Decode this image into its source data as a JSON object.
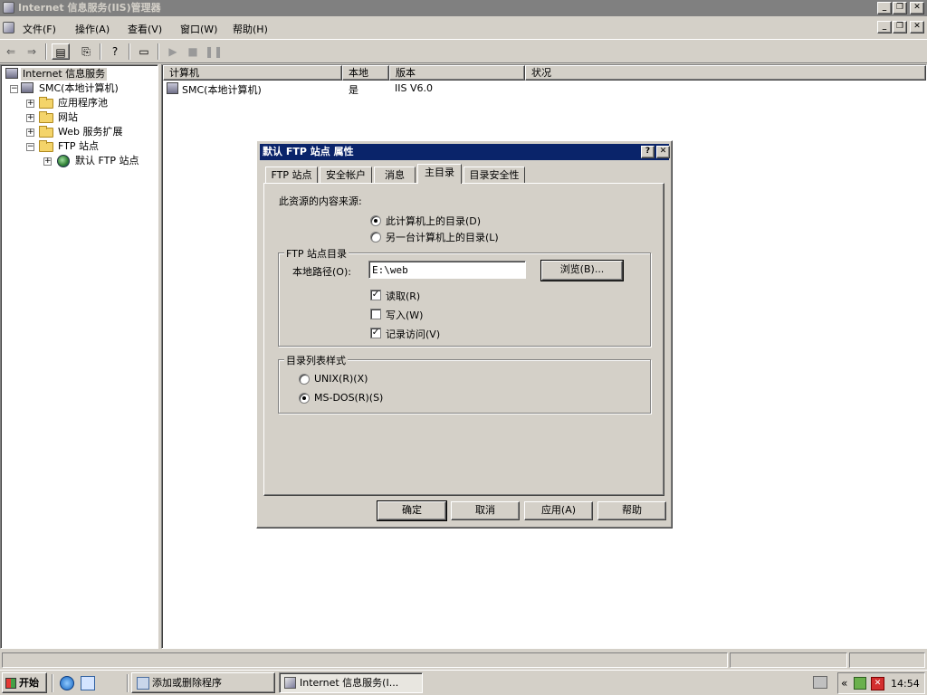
{
  "window": {
    "title": "Internet 信息服务(IIS)管理器"
  },
  "menu": [
    "文件(F)",
    "操作(A)",
    "查看(V)",
    "窗口(W)",
    "帮助(H)"
  ],
  "tree": {
    "root": "Internet 信息服务",
    "computer": "SMC(本地计算机)",
    "app_pools": "应用程序池",
    "websites": "网站",
    "web_ext": "Web 服务扩展",
    "ftp_sites": "FTP 站点",
    "default_ftp": "默认 FTP 站点"
  },
  "list": {
    "columns": [
      "计算机",
      "本地",
      "版本",
      "状况"
    ],
    "rows": [
      {
        "computer": "SMC(本地计算机)",
        "local": "是",
        "version": "IIS V6.0",
        "status": ""
      }
    ]
  },
  "dialog": {
    "title": "默认 FTP 站点 属性",
    "tabs": [
      "FTP 站点",
      "安全帐户",
      "消息",
      "主目录",
      "目录安全性"
    ],
    "active_tab": "主目录",
    "source_label": "此资源的内容来源:",
    "source_options": [
      "此计算机上的目录(D)",
      "另一台计算机上的目录(L)"
    ],
    "group_dir": "FTP 站点目录",
    "local_path_label": "本地路径(O):",
    "local_path_value": "E:\\web",
    "browse_button": "浏览(B)...",
    "perm_read": "读取(R)",
    "perm_write": "写入(W)",
    "perm_log": "记录访问(V)",
    "group_style": "目录列表样式",
    "style_unix": "UNIX(R)(X)",
    "style_msdos": "MS-DOS(R)(S)",
    "buttons": {
      "ok": "确定",
      "cancel": "取消",
      "apply": "应用(A)",
      "help": "帮助"
    }
  },
  "taskbar": {
    "start": "开始",
    "tasks": [
      "添加或删除程序",
      "Internet 信息服务(I..."
    ],
    "clock": "14:54",
    "tray_chevron": "«"
  }
}
